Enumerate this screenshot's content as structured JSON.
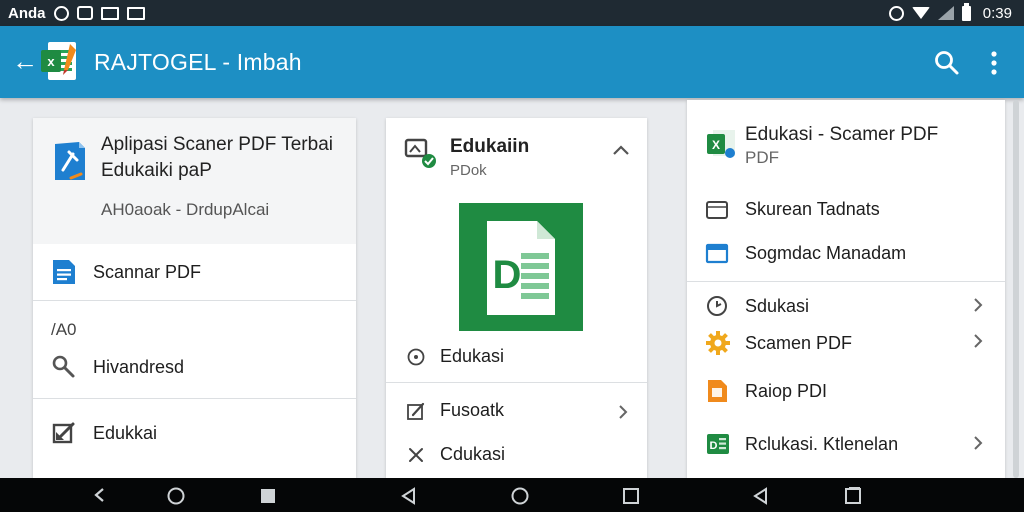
{
  "status_bar": {
    "left_text": "Anda",
    "time": "0:39"
  },
  "app_bar": {
    "title": "RAJTOGEL - Imbah"
  },
  "panel_left": {
    "header_title_line1": "Aplipasi Scaner PDF Terbai",
    "header_title_line2": "Edukaiki paP",
    "header_subtitle": "AH0aoak - DrdupAlcai",
    "items": [
      {
        "label": "Scannar PDF"
      },
      {
        "label": "/A0"
      },
      {
        "label": "Hivandresd"
      },
      {
        "label": "Edukkai"
      }
    ]
  },
  "panel_middle": {
    "title": "Edukaiin",
    "subtitle": "PDok",
    "doc_letter": "D",
    "items": [
      {
        "label": "Edukasi"
      },
      {
        "label": "Fusoatk"
      },
      {
        "label": "Cdukasi"
      }
    ]
  },
  "panel_right": {
    "header_title": "Edukasi - Scamer PDF",
    "header_subtitle": "PDF",
    "items": [
      {
        "label": "Skurean Tadnats"
      },
      {
        "label": "Sogmdac Manadam"
      },
      {
        "label": "Sdukasi"
      },
      {
        "label": "Scamen PDF"
      },
      {
        "label": "Raiop PDI"
      },
      {
        "label": "Rclukasi. Ktlenelan"
      }
    ]
  },
  "colors": {
    "app_bar": "#1d8fc4",
    "status_bar": "#1f2a33",
    "excel_green": "#1f8b42",
    "accent_blue": "#1e7fd0",
    "orange": "#f08a1c"
  }
}
